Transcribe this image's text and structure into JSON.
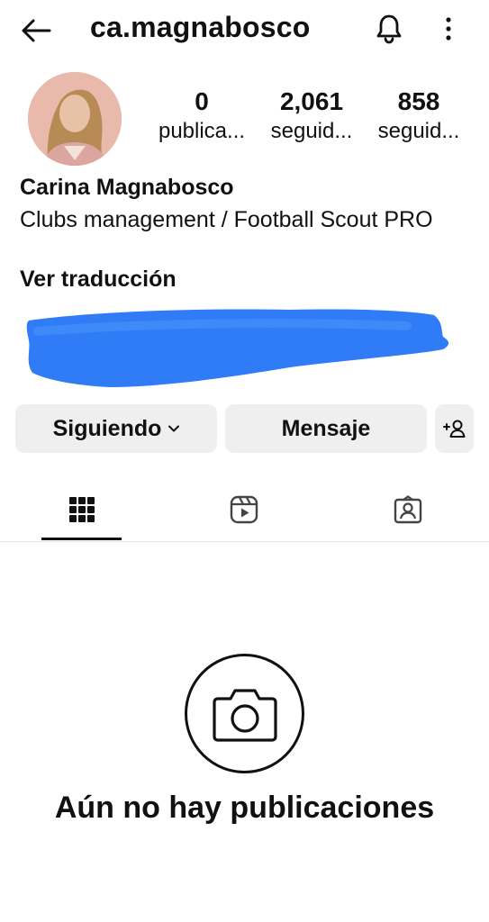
{
  "header": {
    "username": "ca.magnabosco",
    "back_icon": "arrow-left-icon",
    "notifications_icon": "bell-icon",
    "more_icon": "more-vertical-icon"
  },
  "profile": {
    "avatar_icon": "profile-photo",
    "stats": [
      {
        "value": "0",
        "label": "publica..."
      },
      {
        "value": "2,061",
        "label": "seguid..."
      },
      {
        "value": "858",
        "label": "seguid..."
      }
    ],
    "name": "Carina Magnabosco",
    "bio": "Clubs management / Football Scout PRO",
    "translate_link": "Ver traducción"
  },
  "actions": {
    "following_label": "Siguiendo",
    "message_label": "Mensaje",
    "add_person_icon": "add-person-icon"
  },
  "tabs": [
    {
      "icon": "grid-icon",
      "active": true
    },
    {
      "icon": "reels-icon",
      "active": false
    },
    {
      "icon": "tagged-icon",
      "active": false
    }
  ],
  "empty_state": {
    "icon": "camera-icon",
    "title": "Aún no hay publicaciones"
  },
  "colors": {
    "redaction": "#2f7cf6",
    "button_bg": "#efefef",
    "text": "#111111"
  }
}
